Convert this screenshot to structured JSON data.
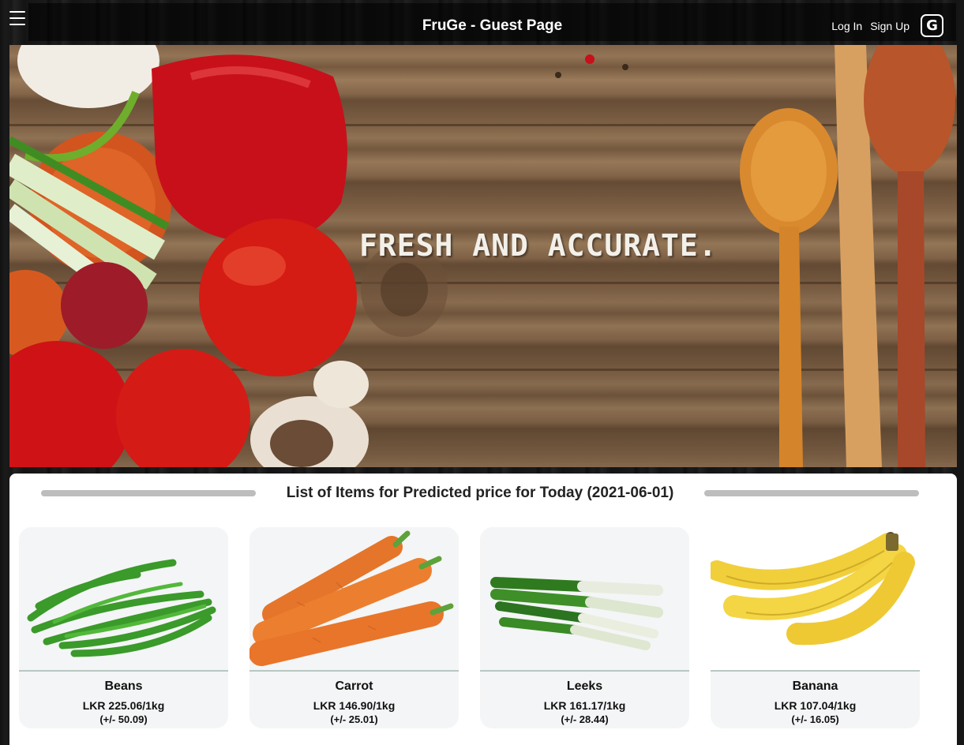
{
  "navbar": {
    "title": "FruGe - Guest Page",
    "login_label": "Log In",
    "signup_label": "Sign Up",
    "account_initial": "G",
    "menu_icon": "hamburger-icon"
  },
  "hero": {
    "text": "FRESH AND ACCURATE."
  },
  "section": {
    "title": "List of Items for Predicted price for Today (2021-06-01)"
  },
  "items": [
    {
      "name": "Beans",
      "price": "LKR 225.06/1kg",
      "range": "(+/- 50.09)",
      "icon": "beans-image"
    },
    {
      "name": "Carrot",
      "price": "LKR 146.90/1kg",
      "range": "(+/- 25.01)",
      "icon": "carrot-image"
    },
    {
      "name": "Leeks",
      "price": "LKR 161.17/1kg",
      "range": "(+/- 28.44)",
      "icon": "leeks-image"
    },
    {
      "name": "Banana",
      "price": "LKR 107.04/1kg",
      "range": "(+/- 16.05)",
      "icon": "banana-image"
    }
  ],
  "colors": {
    "card_bg": "#f4f5f6",
    "divider": "#b9c7c3"
  }
}
